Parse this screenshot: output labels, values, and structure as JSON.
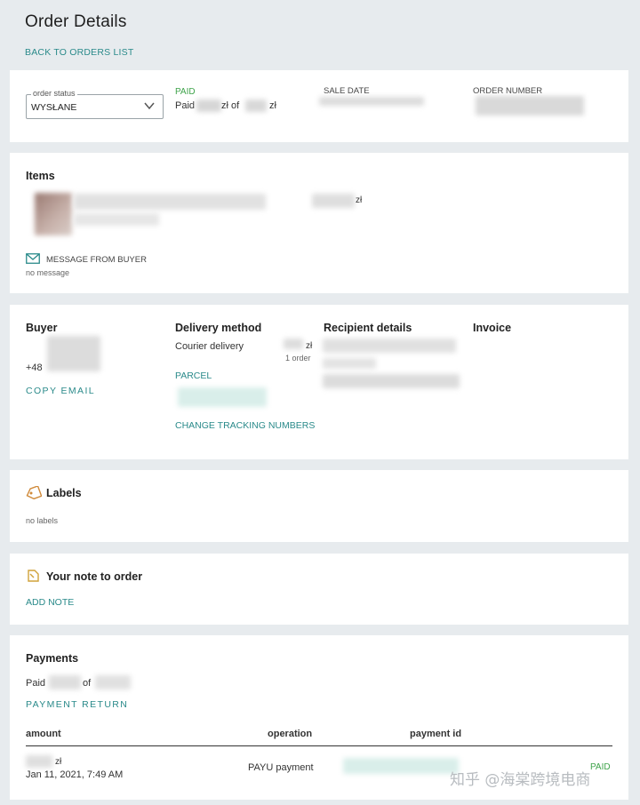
{
  "header": {
    "title": "Order Details",
    "back_link": "BACK TO ORDERS LIST"
  },
  "summary": {
    "status_legend": "order status",
    "status_value": "WYSŁANE",
    "paid_badge": "PAID",
    "paid_text_prefix": "Paid",
    "paid_currency_1": "zł of",
    "paid_currency_2": "zł",
    "sale_date_label": "SALE DATE",
    "order_number_label": "ORDER NUMBER"
  },
  "items": {
    "title": "Items",
    "price_currency": "zł",
    "message_label": "MESSAGE FROM BUYER",
    "message_value": "no message"
  },
  "details": {
    "buyer_title": "Buyer",
    "buyer_phone_prefix": "+48",
    "copy_email": "COPY EMAIL",
    "delivery_title": "Delivery method",
    "delivery_value": "Courier delivery",
    "delivery_currency": "zł",
    "delivery_orders": "1 order",
    "parcel_label": "PARCEL",
    "change_tracking": "CHANGE TRACKING NUMBERS",
    "recipient_title": "Recipient details",
    "invoice_title": "Invoice"
  },
  "labels": {
    "title": "Labels",
    "empty": "no labels"
  },
  "note": {
    "title": "Your note to order",
    "add_note": "ADD NOTE"
  },
  "payments": {
    "title": "Payments",
    "paid_prefix": "Paid",
    "paid_of": "of",
    "payment_return": "PAYMENT RETURN",
    "columns": {
      "amount": "amount",
      "operation": "operation",
      "payment_id": "payment id"
    },
    "row": {
      "amount_currency": "zł",
      "date": "Jan 11, 2021, 7:49 AM",
      "operation": "PAYU payment",
      "status": "PAID"
    }
  },
  "watermark": "知乎 @海棠跨境电商",
  "colors": {
    "accent": "#2a8a8a",
    "paid_green": "#3ea34a",
    "background": "#e7ebee"
  },
  "icons": [
    "chevron-down-icon",
    "envelope-icon",
    "tag-icon",
    "note-icon"
  ]
}
